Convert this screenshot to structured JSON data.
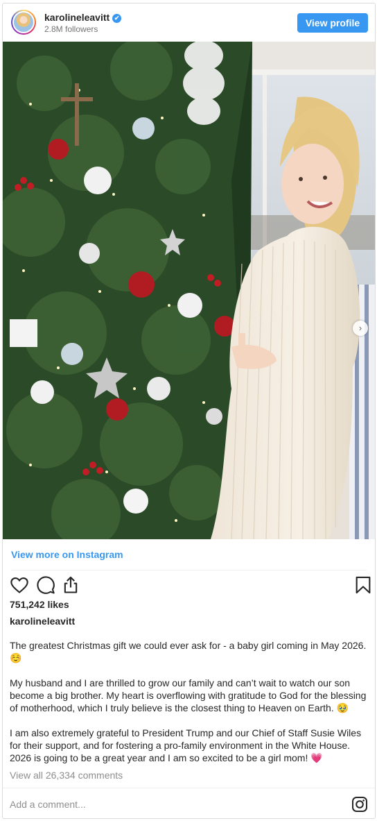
{
  "header": {
    "username": "karolineleavitt",
    "verified_glyph": "✔",
    "followers": "2.8M followers",
    "view_profile_label": "View profile"
  },
  "post": {
    "image_icon": "photo",
    "carousel_dots": 4,
    "carousel_active": 0,
    "next_arrow": "›"
  },
  "links": {
    "view_more": "View more on Instagram"
  },
  "actions": {
    "like_icon": "heart-icon",
    "comment_icon": "comment-icon",
    "share_icon": "share-icon",
    "save_icon": "bookmark-icon"
  },
  "likes": "751,242 likes",
  "caption": {
    "username": "karolineleavitt",
    "paragraphs": [
      "The greatest Christmas gift we could ever ask for - a baby girl coming in May 2026. ☺️",
      "My husband and I are thrilled to grow our family and can’t wait to watch our son become a big brother. My heart is overflowing with gratitude to God for the blessing of motherhood, which I truly believe is the closest thing to Heaven on Earth. 🥹",
      "I am also extremely grateful to President Trump and our Chief of Staff Susie Wiles for their support, and for fostering a pro-family environment in the White House. 2026 is going to be a great year and I am so excited to be a girl mom! 💗"
    ]
  },
  "comments_link": "View all 26,334 comments",
  "add_comment_placeholder": "Add a comment...",
  "colors": {
    "accent": "#3897f0",
    "muted": "#8e8e8e",
    "border": "#dbdbdb"
  }
}
